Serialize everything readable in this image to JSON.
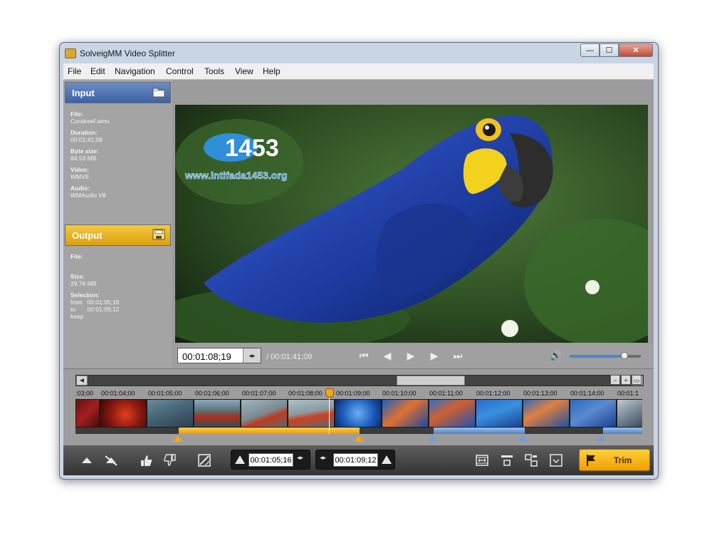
{
  "window": {
    "title": "SolveigMM Video Splitter",
    "close_glyph": "✕",
    "min_glyph": "—",
    "max_glyph": "☐"
  },
  "menu": [
    "File",
    "Edit",
    "Navigation",
    "Control",
    "Tools",
    "View",
    "Help"
  ],
  "input": {
    "title": "Input",
    "file_label": "File:",
    "file": "Coralreef.wmv",
    "duration_label": "Duration:",
    "duration": "00:01:41;09",
    "bytesize_label": "Byte size:",
    "bytesize": "84.53 MB",
    "video_label": "Video:",
    "video": "WMV9",
    "audio_label": "Audio:",
    "audio": "WMAudio V8"
  },
  "output": {
    "title": "Output",
    "file_label": "File:",
    "size_label": "Size:",
    "size": "29.76 MB",
    "selection_label": "Selection:",
    "from_label": "from",
    "from": "00:01:05;16",
    "to_label": "to",
    "to": "00:01:09;12",
    "keep": "keep"
  },
  "watermark": {
    "logo": "1453",
    "url": "www.intifada1453.org"
  },
  "player": {
    "current_time": "00:01:08;19",
    "total_time": "/ 00:01:41;09",
    "volume": 0.77,
    "buttons": [
      "⏮",
      "◀",
      "▶",
      "▶",
      "⏭"
    ]
  },
  "timeline": {
    "ruler": [
      ":03;00",
      "00:01:04;00",
      "00:01:05;00",
      "00:01:06;00",
      "00:01:07;00",
      "00:01:08;00",
      "00:01:09;00",
      "00:01:10;00",
      "00:01:11;00",
      "00:01:12;00",
      "00:01:13;00",
      "00:01:14;00",
      "00:01:1"
    ],
    "scroll_left": "◀",
    "scroll_right": "▶",
    "zoom_out": "−",
    "zoom_in": "+",
    "zoom_fit": "▭"
  },
  "toolbar": {
    "start_time": "00:01:05;16",
    "end_time": "00:01:09;12",
    "arrows": "◂▸",
    "trim_label": "Trim"
  },
  "colors": {
    "input_header": "#3c62a4",
    "output_header": "#dba10e",
    "selection": "#f0a615",
    "segment_blue": "#6f9ed8",
    "trim_button": "#ffc21a"
  }
}
